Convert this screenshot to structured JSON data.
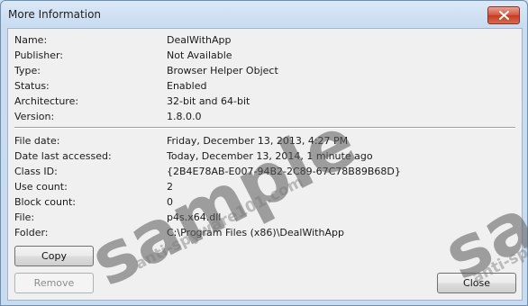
{
  "window": {
    "title": "More Information"
  },
  "properties": [
    {
      "label": "Name:",
      "value": "DealWithApp"
    },
    {
      "label": "Publisher:",
      "value": "Not Available"
    },
    {
      "label": "Type:",
      "value": "Browser Helper Object"
    },
    {
      "label": "Status:",
      "value": "Enabled"
    },
    {
      "label": "Architecture:",
      "value": "32-bit and 64-bit"
    },
    {
      "label": "Version:",
      "value": "1.8.0.0"
    }
  ],
  "file_info": [
    {
      "label": "File date:",
      "value": "Friday, December 13, 2013, 4:27 PM"
    },
    {
      "label": "Date last accessed:",
      "value": "Today, December 13, 2014, 1 minute ago"
    },
    {
      "label": "Class ID:",
      "value": "{2B4E78AB-E007-94B2-2C89-67C78B89B68D}"
    },
    {
      "label": "Use count:",
      "value": "2"
    },
    {
      "label": "Block count:",
      "value": "0"
    },
    {
      "label": "File:",
      "value": "p4s.x64.dll"
    },
    {
      "label": "Folder:",
      "value": "C:\\Program Files (x86)\\DealWithApp"
    }
  ],
  "buttons": {
    "copy": "Copy",
    "remove": "Remove",
    "close": "Close"
  },
  "watermark": {
    "main": "sample",
    "sub": "anti-spyware101.com"
  },
  "colors": {
    "close_button": "#c43b22",
    "title_bar": "#c9dcf0"
  }
}
